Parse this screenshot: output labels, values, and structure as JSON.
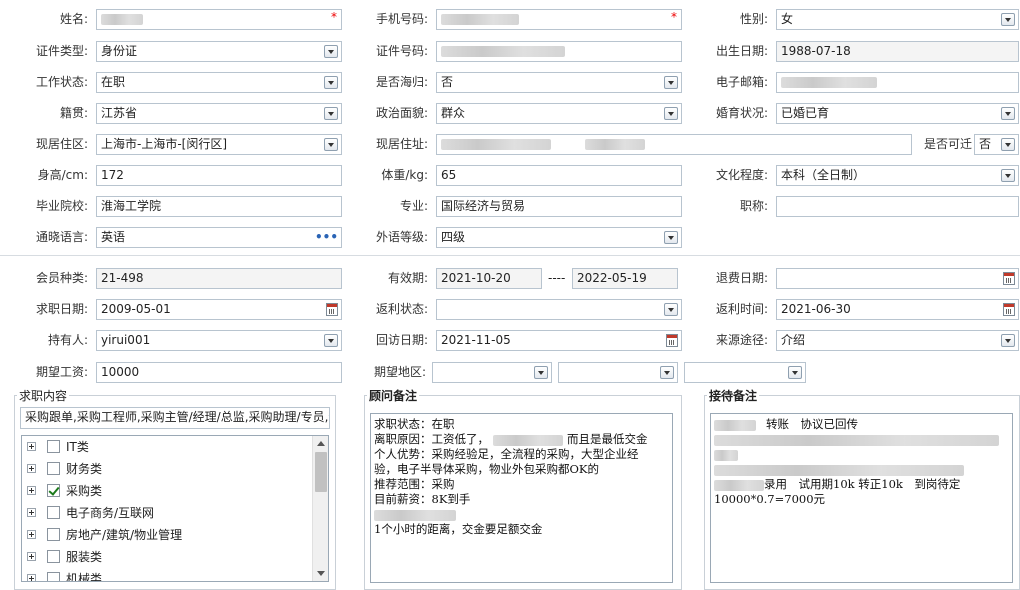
{
  "form": {
    "name": {
      "label": "姓名:"
    },
    "mobile": {
      "label": "手机号码:"
    },
    "gender": {
      "label": "性别:",
      "value": "女"
    },
    "id_type": {
      "label": "证件类型:",
      "value": "身份证"
    },
    "id_no": {
      "label": "证件号码:"
    },
    "birth": {
      "label": "出生日期:",
      "value": "1988-07-18"
    },
    "work_status": {
      "label": "工作状态:",
      "value": "在职"
    },
    "returnee": {
      "label": "是否海归:",
      "value": "否"
    },
    "email": {
      "label": "电子邮箱:"
    },
    "native": {
      "label": "籍贯:",
      "value": "江苏省"
    },
    "politics": {
      "label": "政治面貌:",
      "value": "群众"
    },
    "marriage": {
      "label": "婚育状况:",
      "value": "已婚已育"
    },
    "residence_area": {
      "label": "现居住区:",
      "value": "上海市-上海市-[闵行区]"
    },
    "residence_addr": {
      "label": "现居住址:"
    },
    "relocate": {
      "label": "是否可迁",
      "value": "否"
    },
    "height": {
      "label": "身高/cm:",
      "value": "172"
    },
    "weight": {
      "label": "体重/kg:",
      "value": "65"
    },
    "education": {
      "label": "文化程度:",
      "value": "本科（全日制）"
    },
    "school": {
      "label": "毕业院校:",
      "value": "淮海工学院"
    },
    "major": {
      "label": "专业:",
      "value": "国际经济与贸易"
    },
    "title": {
      "label": "职称:",
      "value": ""
    },
    "language": {
      "label": "通晓语言:",
      "value": "英语"
    },
    "lang_level": {
      "label": "外语等级:",
      "value": "四级"
    },
    "member_type": {
      "label": "会员种类:",
      "value": "21-498"
    },
    "valid": {
      "label": "有效期:",
      "from": "2021-10-20",
      "sep": "----",
      "to": "2022-05-19"
    },
    "refund_date": {
      "label": "退费日期:",
      "value": ""
    },
    "job_date": {
      "label": "求职日期:",
      "value": "2009-05-01"
    },
    "rebate_status": {
      "label": "返利状态:",
      "value": ""
    },
    "rebate_time": {
      "label": "返利时间:",
      "value": "2021-06-30"
    },
    "holder": {
      "label": "持有人:",
      "value": "yirui001"
    },
    "visit_date": {
      "label": "回访日期:",
      "value": "2021-11-05"
    },
    "source": {
      "label": "来源途径:",
      "value": "介绍"
    },
    "salary": {
      "label": "期望工资:",
      "value": "10000"
    },
    "region": {
      "label": "期望地区:"
    }
  },
  "job_intent": {
    "title": "求职内容",
    "summary": "采购跟单,采购工程师,采购主管/经理/总监,采购助理/专员,仓",
    "tree": [
      {
        "label": "IT类",
        "checked": false
      },
      {
        "label": "财务类",
        "checked": false
      },
      {
        "label": "采购类",
        "checked": true
      },
      {
        "label": "电子商务/互联网",
        "checked": false
      },
      {
        "label": "房地产/建筑/物业管理",
        "checked": false
      },
      {
        "label": "服装类",
        "checked": false
      },
      {
        "label": "机械类",
        "checked": false
      }
    ]
  },
  "advisor_notes": {
    "title": "顾问备注",
    "l1": "求职状态：在职",
    "l2a": "离职原因：工资低了，",
    "l2b": "而且是最低交金",
    "l3": "个人优势：采购经验足，全流程的采购，大型企业经",
    "l4": "验，电子半导体采购，物业外包采购都OK的",
    "l5": "推荐范围：采购",
    "l6": "目前薪资：8K到手",
    "l8": "1个小时的距离，交金要足额交金"
  },
  "reception_notes": {
    "title": "接待备注",
    "l1b": "转账　协议已回传",
    "l5b": "录用　试用期10k 转正10k　到岗待定",
    "l6": "10000*0.7=7000元"
  },
  "icons": {
    "dropdown": "chevron-down-icon",
    "calendar": "calendar-icon",
    "more": "more-icon",
    "expand": "plus-icon",
    "checkbox": "checkbox-icon"
  }
}
